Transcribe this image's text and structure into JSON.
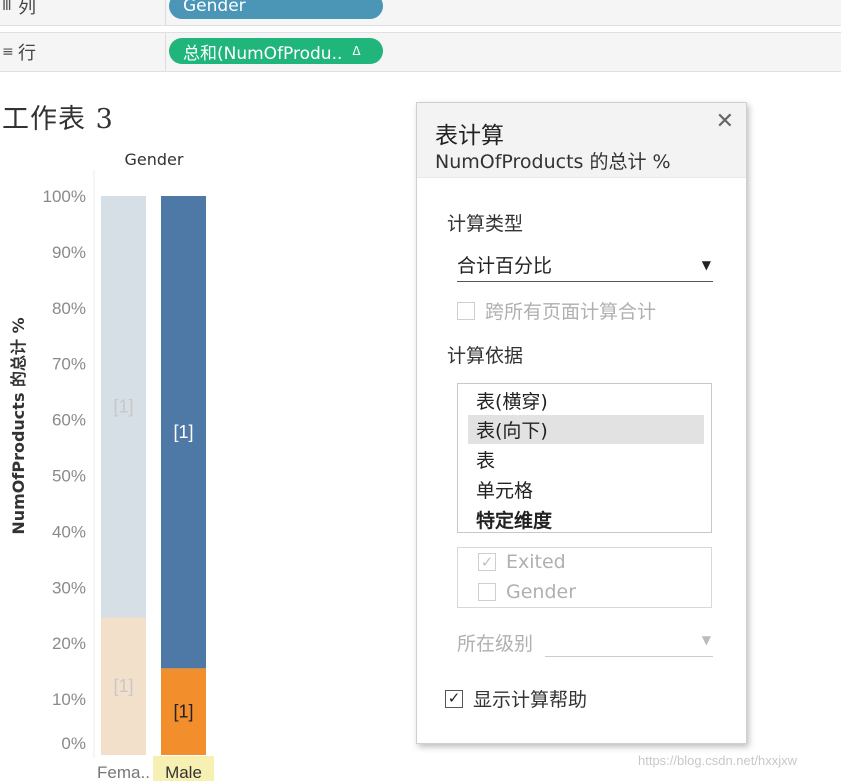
{
  "shelves": {
    "columns": {
      "icon": "columns-icon",
      "label": "列",
      "pill": "Gender"
    },
    "rows": {
      "icon": "rows-icon",
      "label": "行",
      "pill": "总和(NumOfProdu..",
      "delta": "Δ"
    }
  },
  "sheet_title": "工作表 3",
  "chart_data": {
    "type": "bar",
    "stacked": true,
    "header": "Gender",
    "ylabel": "NumOfProducts 的总计 %",
    "ylim": [
      0,
      100
    ],
    "yticks": [
      "0%",
      "10%",
      "20%",
      "30%",
      "40%",
      "50%",
      "60%",
      "70%",
      "80%",
      "90%",
      "100%"
    ],
    "categories": [
      "Fema..",
      "Male"
    ],
    "selected_category": "Male",
    "series": [
      {
        "values": [
          24.6,
          15.5
        ],
        "colors": [
          "#f2e0cb",
          "#f28e2b"
        ],
        "label": "[1]"
      },
      {
        "values": [
          75.4,
          84.5
        ],
        "colors": [
          "#d6dee6",
          "#4e79a7"
        ],
        "label": "[1]"
      }
    ],
    "grid": false
  },
  "dialog": {
    "title": "表计算",
    "subtitle": "NumOfProducts 的总计 %",
    "close_icon": "close-icon",
    "calc_type_label": "计算类型",
    "calc_type_value": "合计百分比",
    "across_pages_label": "跨所有页面计算合计",
    "compute_using_label": "计算依据",
    "compute_using_options": [
      "表(横穿)",
      "表(向下)",
      "表",
      "单元格",
      "特定维度"
    ],
    "selected_option": "表(向下)",
    "dimensions": [
      {
        "label": "Exited",
        "checked": true
      },
      {
        "label": "Gender",
        "checked": false
      }
    ],
    "level_label": "所在级别",
    "show_help_label": "显示计算帮助",
    "show_help_checked": true
  },
  "watermark": "https://blog.csdn.net/hxxjxw"
}
